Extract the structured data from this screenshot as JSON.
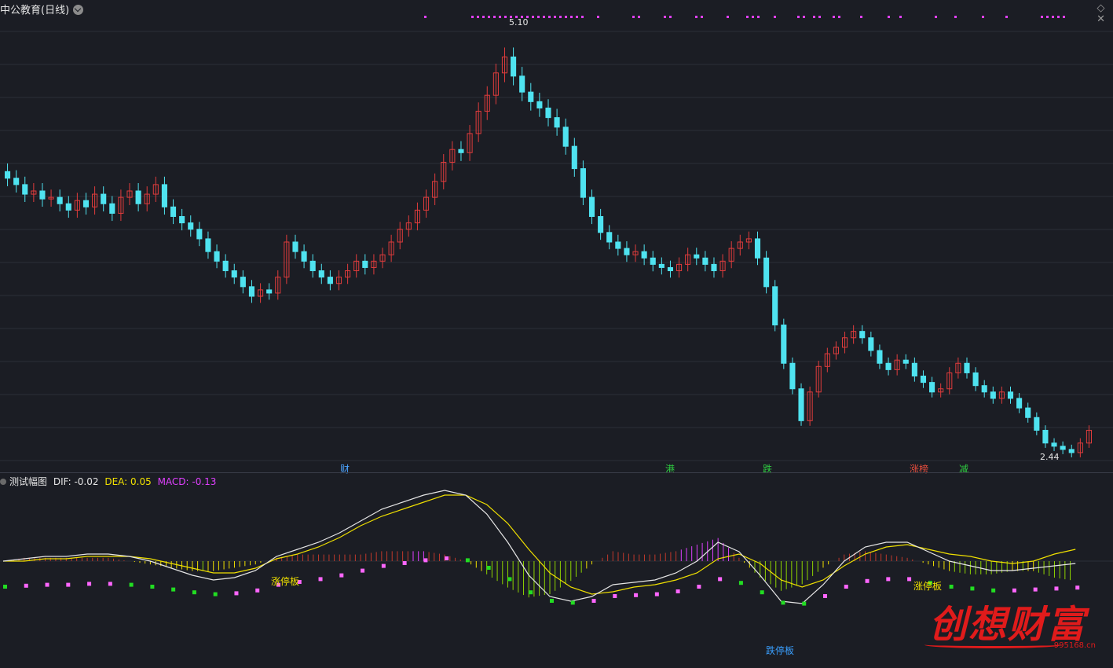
{
  "header": {
    "stock_title": "中公教育(日线)",
    "high_label": "5.10",
    "low_label": "2.44",
    "settings_icon": "diamond-icon",
    "close_icon": "close-icon"
  },
  "event_markers": [
    {
      "text": "财",
      "color": "#4aa3ff"
    },
    {
      "text": "港",
      "color": "#2ecc40"
    },
    {
      "text": "跌",
      "color": "#2ecc40"
    },
    {
      "text": "涨榜",
      "color": "#e74c3c"
    },
    {
      "text": "减",
      "color": "#2ecc40"
    }
  ],
  "indicator": {
    "name": "测试幅图",
    "dif_label": "DIF: -0.02",
    "dea_label": "DEA: 0.05",
    "macd_label": "MACD: -0.13",
    "dif_color": "#e6e6e6",
    "dea_color": "#f0e000",
    "macd_color": "#e040ff",
    "tags": [
      {
        "text": "涨停板",
        "color": "#f0e000"
      },
      {
        "text": "跌停板",
        "color": "#3aa0ff"
      },
      {
        "text": "涨停板",
        "color": "#f0e000"
      }
    ]
  },
  "colors": {
    "background": "#1b1d24",
    "up": "#e03c3c",
    "down": "#4fe3f0",
    "magenta": "#e040ff",
    "grid": "#2b2e38"
  },
  "watermark": {
    "text": "创想财富",
    "url": "995168.cn"
  },
  "chart_data": {
    "type": "candlestick",
    "title": "中公教育(日线)",
    "price_high": 5.1,
    "price_low": 2.44,
    "closes": [
      4.18,
      4.14,
      4.08,
      4.1,
      4.05,
      4.06,
      4.02,
      3.98,
      4.04,
      4.0,
      4.08,
      4.02,
      3.96,
      4.06,
      4.1,
      4.02,
      4.08,
      4.14,
      4.0,
      3.94,
      3.9,
      3.86,
      3.8,
      3.72,
      3.66,
      3.6,
      3.56,
      3.5,
      3.44,
      3.48,
      3.46,
      3.56,
      3.78,
      3.72,
      3.66,
      3.6,
      3.56,
      3.52,
      3.56,
      3.6,
      3.66,
      3.62,
      3.66,
      3.7,
      3.78,
      3.86,
      3.9,
      3.98,
      4.06,
      4.16,
      4.28,
      4.36,
      4.34,
      4.46,
      4.6,
      4.7,
      4.84,
      4.94,
      4.82,
      4.72,
      4.66,
      4.62,
      4.56,
      4.5,
      4.38,
      4.24,
      4.06,
      3.94,
      3.84,
      3.78,
      3.74,
      3.7,
      3.72,
      3.68,
      3.64,
      3.62,
      3.6,
      3.64,
      3.7,
      3.68,
      3.64,
      3.6,
      3.66,
      3.74,
      3.78,
      3.8,
      3.68,
      3.5,
      3.26,
      3.02,
      2.86,
      2.66,
      2.84,
      3.0,
      3.08,
      3.12,
      3.18,
      3.22,
      3.18,
      3.1,
      3.02,
      2.98,
      3.04,
      3.02,
      2.94,
      2.9,
      2.84,
      2.86,
      2.96,
      3.02,
      2.96,
      2.88,
      2.84,
      2.8,
      2.84,
      2.8,
      2.74,
      2.68,
      2.6,
      2.52,
      2.5,
      2.48,
      2.46,
      2.52,
      2.6
    ],
    "dif": [
      0.0,
      0.01,
      0.02,
      0.02,
      0.03,
      0.03,
      0.02,
      0.0,
      -0.03,
      -0.06,
      -0.08,
      -0.07,
      -0.04,
      0.02,
      0.05,
      0.08,
      0.12,
      0.17,
      0.22,
      0.25,
      0.28,
      0.3,
      0.28,
      0.2,
      0.08,
      -0.06,
      -0.15,
      -0.17,
      -0.15,
      -0.1,
      -0.09,
      -0.08,
      -0.05,
      0.0,
      0.08,
      0.04,
      -0.06,
      -0.17,
      -0.18,
      -0.1,
      0.0,
      0.06,
      0.08,
      0.08,
      0.04,
      0.0,
      -0.02,
      -0.04,
      -0.04,
      -0.03,
      -0.02,
      -0.01
    ],
    "dea": [
      0.0,
      0.0,
      0.01,
      0.01,
      0.02,
      0.02,
      0.02,
      0.01,
      -0.01,
      -0.03,
      -0.05,
      -0.05,
      -0.03,
      0.01,
      0.03,
      0.06,
      0.1,
      0.15,
      0.19,
      0.22,
      0.25,
      0.28,
      0.28,
      0.24,
      0.16,
      0.05,
      -0.05,
      -0.11,
      -0.14,
      -0.13,
      -0.11,
      -0.1,
      -0.08,
      -0.05,
      0.01,
      0.03,
      -0.01,
      -0.08,
      -0.11,
      -0.08,
      -0.02,
      0.03,
      0.06,
      0.07,
      0.05,
      0.03,
      0.02,
      0.0,
      -0.01,
      0.0,
      0.03,
      0.05
    ],
    "xlabel": "",
    "ylabel": ""
  }
}
